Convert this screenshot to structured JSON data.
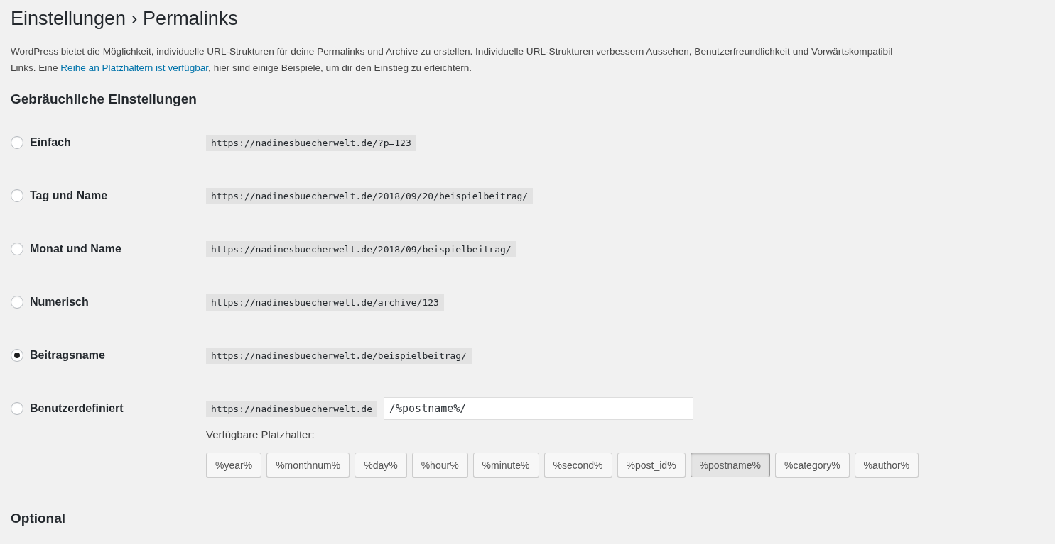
{
  "page_title": "Einstellungen › Permalinks",
  "intro": {
    "line1": "WordPress bietet die Möglichkeit, individuelle URL-Strukturen für deine Permalinks und Archive zu erstellen. Individuelle URL-Strukturen verbessern Aussehen, Benutzerfreundlichkeit und Vorwärtskompatibil",
    "line2_before": "Links. Eine ",
    "link": "Reihe an Platzhaltern ist verfügbar",
    "line2_after": ", hier sind einige Beispiele, um dir den Einstieg zu erleichtern."
  },
  "section_title": "Gebräuchliche Einstellungen",
  "options": [
    {
      "label": "Einfach",
      "example": "https://nadinesbuecherwelt.de/?p=123",
      "selected": false
    },
    {
      "label": "Tag und Name",
      "example": "https://nadinesbuecherwelt.de/2018/09/20/beispielbeitrag/",
      "selected": false
    },
    {
      "label": "Monat und Name",
      "example": "https://nadinesbuecherwelt.de/2018/09/beispielbeitrag/",
      "selected": false
    },
    {
      "label": "Numerisch",
      "example": "https://nadinesbuecherwelt.de/archive/123",
      "selected": false
    },
    {
      "label": "Beitragsname",
      "example": "https://nadinesbuecherwelt.de/beispielbeitrag/",
      "selected": true
    },
    {
      "label": "Benutzerdefiniert",
      "example": "https://nadinesbuecherwelt.de",
      "value": "/%postname%/",
      "selected": false
    }
  ],
  "placeholders_label": "Verfügbare Platzhalter:",
  "tags": [
    {
      "label": "%year%",
      "selected": false
    },
    {
      "label": "%monthnum%",
      "selected": false
    },
    {
      "label": "%day%",
      "selected": false
    },
    {
      "label": "%hour%",
      "selected": false
    },
    {
      "label": "%minute%",
      "selected": false
    },
    {
      "label": "%second%",
      "selected": false
    },
    {
      "label": "%post_id%",
      "selected": false
    },
    {
      "label": "%postname%",
      "selected": true
    },
    {
      "label": "%category%",
      "selected": false
    },
    {
      "label": "%author%",
      "selected": false
    }
  ],
  "optional_title": "Optional"
}
